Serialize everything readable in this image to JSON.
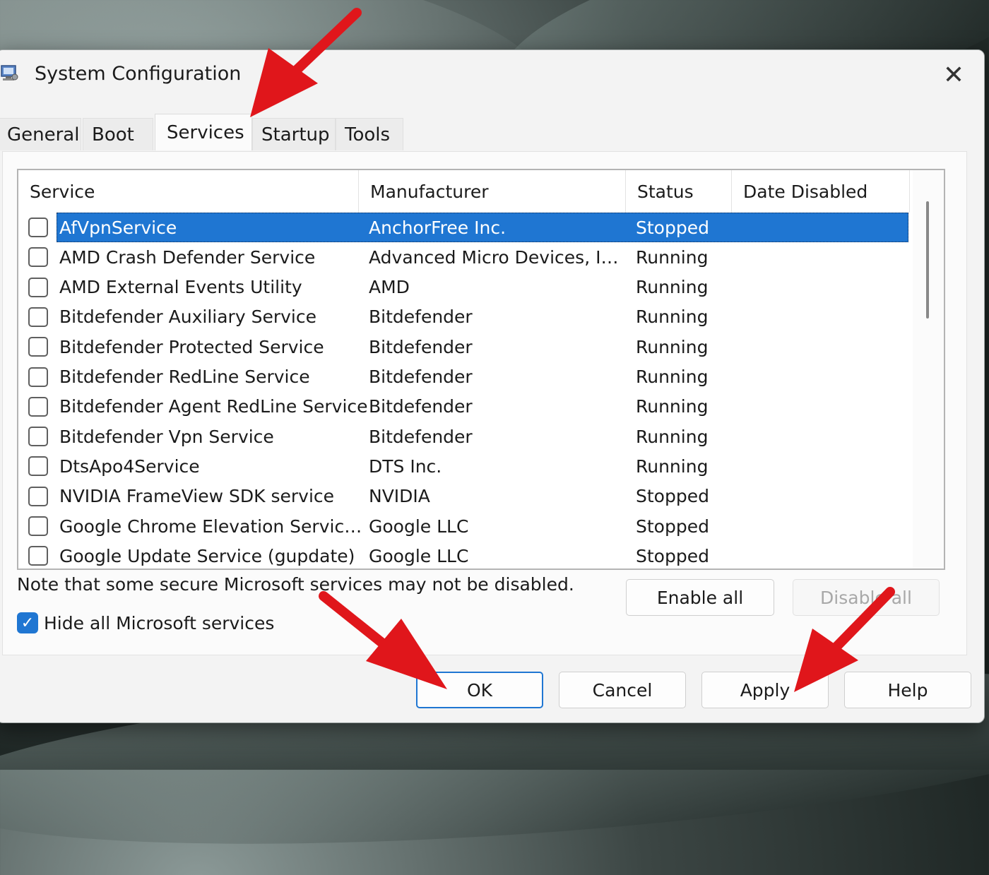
{
  "window": {
    "title": "System Configuration",
    "close_glyph": "✕"
  },
  "tabs": [
    {
      "label": "General",
      "active": false
    },
    {
      "label": "Boot",
      "active": false
    },
    {
      "label": "Services",
      "active": true
    },
    {
      "label": "Startup",
      "active": false
    },
    {
      "label": "Tools",
      "active": false
    }
  ],
  "services_table": {
    "columns": [
      "Service",
      "Manufacturer",
      "Status",
      "Date Disabled"
    ],
    "rows": [
      {
        "service": "AfVpnService",
        "manufacturer": "AnchorFree Inc.",
        "status": "Stopped",
        "date_disabled": "",
        "checked": false,
        "selected": true
      },
      {
        "service": "AMD Crash Defender Service",
        "manufacturer": "Advanced Micro Devices, I…",
        "status": "Running",
        "date_disabled": "",
        "checked": false,
        "selected": false
      },
      {
        "service": "AMD External Events Utility",
        "manufacturer": "AMD",
        "status": "Running",
        "date_disabled": "",
        "checked": false,
        "selected": false
      },
      {
        "service": "Bitdefender Auxiliary Service",
        "manufacturer": "Bitdefender",
        "status": "Running",
        "date_disabled": "",
        "checked": false,
        "selected": false
      },
      {
        "service": "Bitdefender Protected Service",
        "manufacturer": "Bitdefender",
        "status": "Running",
        "date_disabled": "",
        "checked": false,
        "selected": false
      },
      {
        "service": "Bitdefender RedLine Service",
        "manufacturer": "Bitdefender",
        "status": "Running",
        "date_disabled": "",
        "checked": false,
        "selected": false
      },
      {
        "service": "Bitdefender Agent RedLine Service",
        "manufacturer": "Bitdefender",
        "status": "Running",
        "date_disabled": "",
        "checked": false,
        "selected": false
      },
      {
        "service": "Bitdefender Vpn Service",
        "manufacturer": "Bitdefender",
        "status": "Running",
        "date_disabled": "",
        "checked": false,
        "selected": false
      },
      {
        "service": "DtsApo4Service",
        "manufacturer": "DTS Inc.",
        "status": "Running",
        "date_disabled": "",
        "checked": false,
        "selected": false
      },
      {
        "service": "NVIDIA FrameView SDK service",
        "manufacturer": "NVIDIA",
        "status": "Stopped",
        "date_disabled": "",
        "checked": false,
        "selected": false
      },
      {
        "service": "Google Chrome Elevation Servic…",
        "manufacturer": "Google LLC",
        "status": "Stopped",
        "date_disabled": "",
        "checked": false,
        "selected": false
      },
      {
        "service": "Google Update Service (gupdate)",
        "manufacturer": "Google LLC",
        "status": "Stopped",
        "date_disabled": "",
        "checked": false,
        "selected": false
      }
    ]
  },
  "note": "Note that some secure Microsoft services may not be disabled.",
  "buttons": {
    "enable_all": "Enable all",
    "disable_all": "Disable all",
    "ok": "OK",
    "cancel": "Cancel",
    "apply": "Apply",
    "help": "Help"
  },
  "hide_microsoft": {
    "label": "Hide all Microsoft services",
    "checked": true
  },
  "colors": {
    "accent": "#1f76d2",
    "annotation_arrow": "#e0161b"
  }
}
